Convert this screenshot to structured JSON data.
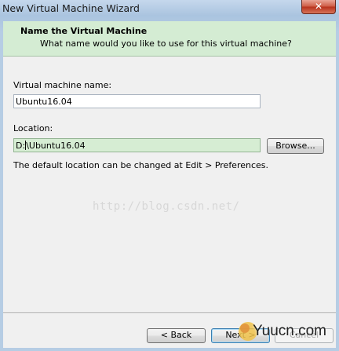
{
  "window": {
    "title": "New Virtual Machine Wizard",
    "close_glyph": "✕"
  },
  "header": {
    "title": "Name the Virtual Machine",
    "subtitle": "What name would you like to use for this virtual machine?"
  },
  "form": {
    "vm_name_label": "Virtual machine name:",
    "vm_name_value": "Ubuntu16.04",
    "location_label": "Location:",
    "location_value_before_caret": "D:",
    "location_value_after_caret": "\\Ubuntu16.04",
    "browse_label": "Browse...",
    "hint": "The default location can be changed at Edit > Preferences."
  },
  "footer": {
    "back_label": "< Back",
    "next_label": "Next >",
    "cancel_label": "Cancel"
  },
  "watermark": "http://blog.csdn.net/",
  "logo_text": "Yuucn.com",
  "colors": {
    "header_bg": "#d4ecd3",
    "focused_field_bg": "#d6edd3",
    "close_button": "#c7452b"
  }
}
